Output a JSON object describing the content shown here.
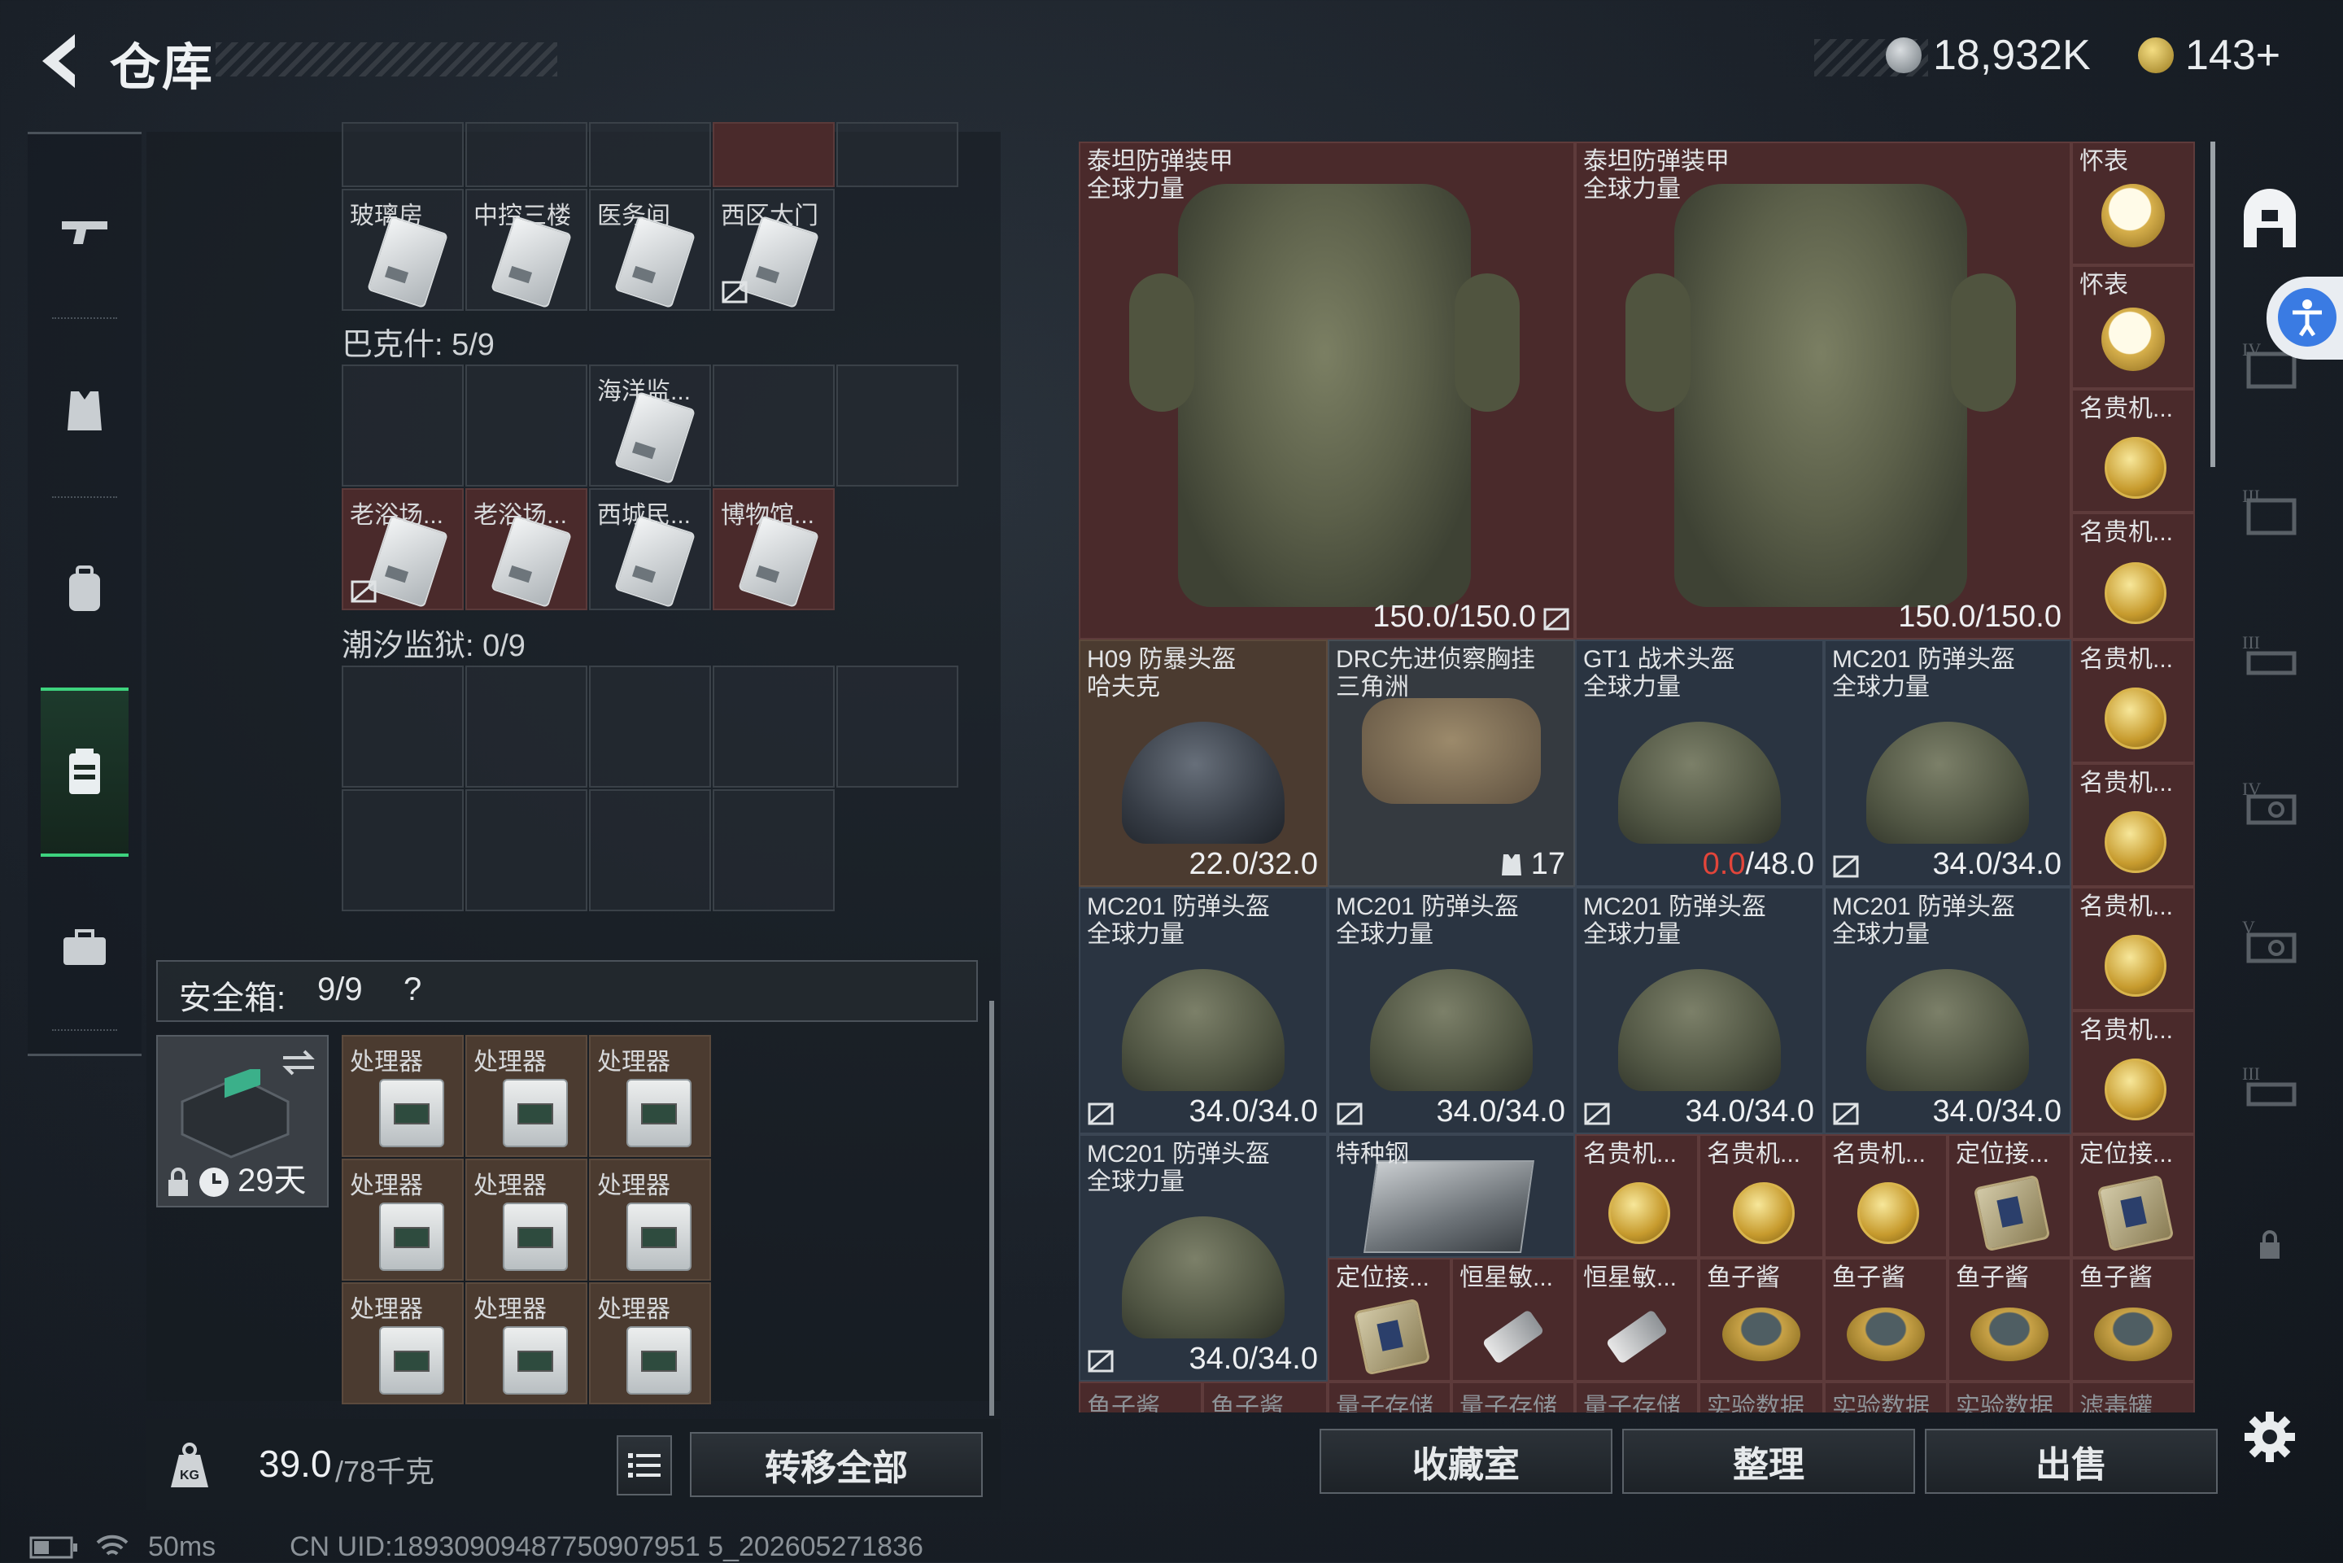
{
  "header": {
    "title": "仓库",
    "currency1": "18,932K",
    "currency2": "143+"
  },
  "colors": {
    "accent_green": "#3ed37e",
    "item_red": "#4a2a2b",
    "item_blue": "#2a3441",
    "item_brown": "#4b3b30",
    "durability_red": "#e2453a"
  },
  "left_nav": {
    "items": [
      "gun-icon",
      "armor-vest-icon",
      "backpack-icon",
      "keycard-case-icon",
      "briefcase-icon"
    ],
    "active": 3
  },
  "keycards": {
    "row_top_labels": [
      "玻璃房",
      "中控三楼",
      "医务间",
      "西区大门"
    ],
    "bakesh_title": "巴克什: 5/9",
    "bakesh_row1": [
      "",
      "",
      "海洋监...",
      "",
      ""
    ],
    "bakesh_row2": [
      "老浴场...",
      "老浴场...",
      "西城民...",
      "博物馆..."
    ],
    "chaoxi_title": "潮汐监狱: 0/9"
  },
  "safe_box": {
    "title": "安全箱:",
    "count": "9/9",
    "help": "?",
    "duration": "29天",
    "items": [
      "处理器",
      "处理器",
      "处理器",
      "处理器",
      "处理器",
      "处理器",
      "处理器",
      "处理器",
      "处理器"
    ]
  },
  "footer_left": {
    "weight_current": "39.0",
    "weight_max": "/78千克",
    "transfer_all": "转移全部"
  },
  "stash": {
    "armor": [
      {
        "name": "泰坦防弹装甲\n全球力量",
        "durability": "150.0/150.0"
      },
      {
        "name": "泰坦防弹装甲\n全球力量",
        "durability": "150.0/150.0"
      }
    ],
    "side_col": [
      "怀表",
      "怀表",
      "名贵机...",
      "名贵机...",
      "名贵机...",
      "名贵机...",
      "名贵机...",
      "名贵机..."
    ],
    "row2": [
      {
        "name": "H09 防暴头盔\n哈夫克",
        "durability": "22.0/32.0"
      },
      {
        "name": "DRC先进侦察胸挂\n三角洲",
        "durability": "17"
      },
      {
        "name": "GT1 战术头盔\n全球力量",
        "dur_red": "0.0",
        "durability": "/48.0"
      },
      {
        "name": "MC201 防弹头盔\n全球力量",
        "durability": "34.0/34.0"
      }
    ],
    "row3": [
      {
        "name": "MC201 防弹头盔\n全球力量",
        "durability": "34.0/34.0"
      },
      {
        "name": "MC201 防弹头盔\n全球力量",
        "durability": "34.0/34.0"
      },
      {
        "name": "MC201 防弹头盔\n全球力量",
        "durability": "34.0/34.0"
      },
      {
        "name": "MC201 防弹头盔\n全球力量",
        "durability": "34.0/34.0"
      }
    ],
    "row4_helmet": {
      "name": "MC201 防弹头盔\n全球力量",
      "durability": "34.0/34.0"
    },
    "steel": "特种钢",
    "row4_small": [
      "名贵机...",
      "名贵机...",
      "名贵机...",
      "定位接...",
      "定位接..."
    ],
    "row5_small": [
      "定位接...",
      "恒星敏...",
      "恒星敏...",
      "鱼子酱",
      "鱼子酱",
      "鱼子酱",
      "鱼子酱"
    ],
    "row6_partial": [
      "鱼子酱",
      "鱼子酱",
      "量子存储",
      "量子存储",
      "量子存储",
      "实验数据",
      "实验数据",
      "实验数据",
      "滤毒罐"
    ]
  },
  "footer_right": {
    "btn1": "收藏室",
    "btn2": "整理",
    "btn3": "出售"
  },
  "right_nav": [
    "safehouse-icon",
    "tier-iv-icon",
    "tier-iii-a-icon",
    "tier-iii-b-icon",
    "tier-iv-b-icon",
    "tier-v-icon",
    "tier-iii-c-icon",
    "lock-icon",
    "gear-icon"
  ],
  "status": {
    "ping": "50ms",
    "uid": "CN UID:18930909487750907951 5_202605271836"
  }
}
